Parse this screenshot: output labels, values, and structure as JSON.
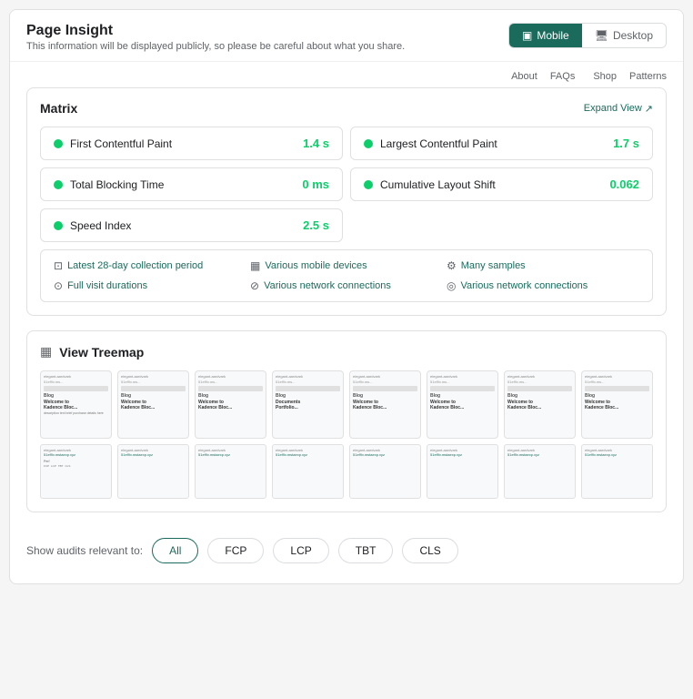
{
  "header": {
    "title": "Page Insight",
    "subtitle": "This information will be displayed publicly, so please be careful about what you share.",
    "mobile_label": "Mobile",
    "desktop_label": "Desktop"
  },
  "mini_nav": {
    "col1": [
      "About",
      "FAQs"
    ],
    "col2": [
      "Shop",
      "Patterns"
    ]
  },
  "matrix": {
    "title": "Matrix",
    "expand_label": "Expand View",
    "metrics": [
      {
        "name": "First Contentful Paint",
        "value": "1.4 s",
        "color": "#0cce6b"
      },
      {
        "name": "Largest Contentful Paint",
        "value": "1.7 s",
        "color": "#0cce6b"
      },
      {
        "name": "Total Blocking Time",
        "value": "0 ms",
        "color": "#0cce6b"
      },
      {
        "name": "Cumulative Layout Shift",
        "value": "0.062",
        "color": "#0cce6b"
      }
    ],
    "speed_index": {
      "name": "Speed Index",
      "value": "2.5 s",
      "color": "#0cce6b"
    }
  },
  "info_tags": [
    {
      "icon": "📅",
      "label": "Latest 28-day collection period"
    },
    {
      "icon": "📱",
      "label": "Various mobile devices"
    },
    {
      "icon": "🔧",
      "label": "Many samples"
    },
    {
      "icon": "⏱",
      "label": "Full visit durations"
    },
    {
      "icon": "📡",
      "label": "Various network connections"
    },
    {
      "icon": "📡",
      "label": "Various network connections"
    }
  ],
  "treemap": {
    "title": "View Treemap",
    "thumbs_top": [
      {
        "site": "Blog",
        "heading": "Welcome to Kadence Bloc..."
      },
      {
        "site": "Blog",
        "heading": "Welcome to Kadence Bloc..."
      },
      {
        "site": "Blog",
        "heading": "Welcome to Kadence Bloc..."
      },
      {
        "site": "Blog",
        "heading": "Documents Portfolio, This pur..."
      },
      {
        "site": "Blog",
        "heading": "Welcome to Kadence Bloc..."
      },
      {
        "site": "Blog",
        "heading": "Welcome to Kadence Bloc..."
      },
      {
        "site": "Blog",
        "heading": "Welcome to Kadence Bloc..."
      },
      {
        "site": "Blog",
        "heading": "Welcome to Kadence Bloc..."
      }
    ],
    "thumbs_bottom": [
      {
        "label": "elegant-aardvark",
        "url": "51ef9v.mstaexp.xyz"
      },
      {
        "label": "elegant-aardvark",
        "url": "51ef9v.mstaexp.xyz"
      },
      {
        "label": "elegant-aardvark",
        "url": "51ef9v.mstaexp.xyz"
      },
      {
        "label": "elegant-aardvark",
        "url": "51ef9v.mstaexp.xyz"
      },
      {
        "label": "elegant-aardvark",
        "url": "51ef9v.mstaexp.xyz"
      },
      {
        "label": "elegant-aardvark",
        "url": "51ef9v.mstaexp.xyz"
      },
      {
        "label": "elegant-aardvark",
        "url": "51ef9v.mstaexp.xyz"
      },
      {
        "label": "elegant-aardvark",
        "url": "51ef9v.mstaexp.xyz"
      }
    ]
  },
  "filters": {
    "label": "Show audits relevant to:",
    "buttons": [
      "All",
      "FCP",
      "LCP",
      "TBT",
      "CLS"
    ],
    "active": "All"
  }
}
